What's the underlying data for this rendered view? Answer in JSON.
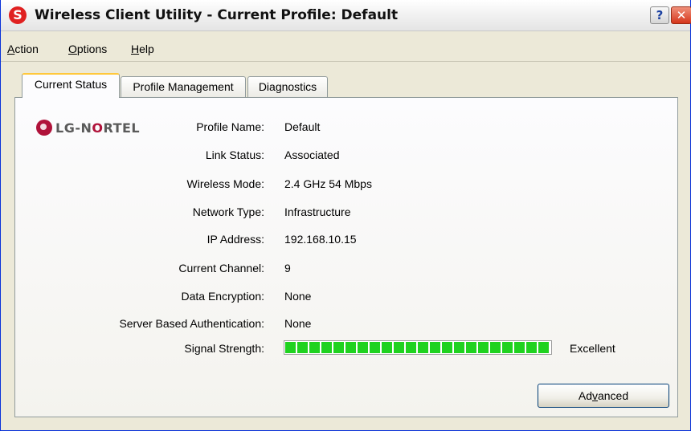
{
  "window": {
    "title": "Wireless Client Utility - Current Profile: Default",
    "icon": "wireless-utility-logo-icon",
    "help_glyph": "?",
    "close_glyph": "✕"
  },
  "menu": {
    "items": [
      {
        "label": "Action",
        "mnemonic": "A",
        "rest": "ction"
      },
      {
        "label": "Options",
        "mnemonic": "O",
        "rest": "ptions"
      },
      {
        "label": "Help",
        "mnemonic": "H",
        "rest": "elp"
      }
    ]
  },
  "tabs": [
    {
      "label": "Current Status",
      "active": true
    },
    {
      "label": "Profile Management",
      "active": false
    },
    {
      "label": "Diagnostics",
      "active": false
    }
  ],
  "logo": {
    "text_lg": "LG",
    "text_sep": "-N",
    "text_o": "O",
    "text_rest": "RTEL"
  },
  "status": {
    "profile_name": {
      "label": "Profile Name:",
      "value": "Default"
    },
    "link_status": {
      "label": "Link Status:",
      "value": "Associated"
    },
    "wireless_mode": {
      "label": "Wireless Mode:",
      "value": "2.4 GHz 54 Mbps"
    },
    "network_type": {
      "label": "Network Type:",
      "value": "Infrastructure"
    },
    "ip_address": {
      "label": "IP Address:",
      "value": "192.168.10.15"
    },
    "current_channel": {
      "label": "Current Channel:",
      "value": "9"
    },
    "data_encryption": {
      "label": "Data Encryption:",
      "value": "None"
    },
    "server_auth": {
      "label": "Server Based Authentication:",
      "value": "None"
    },
    "signal_strength": {
      "label": "Signal Strength:",
      "value": "Excellent",
      "level_fraction": 1.0,
      "color": "#1fd21f"
    }
  },
  "buttons": {
    "advanced": {
      "label": "Advanced",
      "mnemonic": "v"
    }
  }
}
